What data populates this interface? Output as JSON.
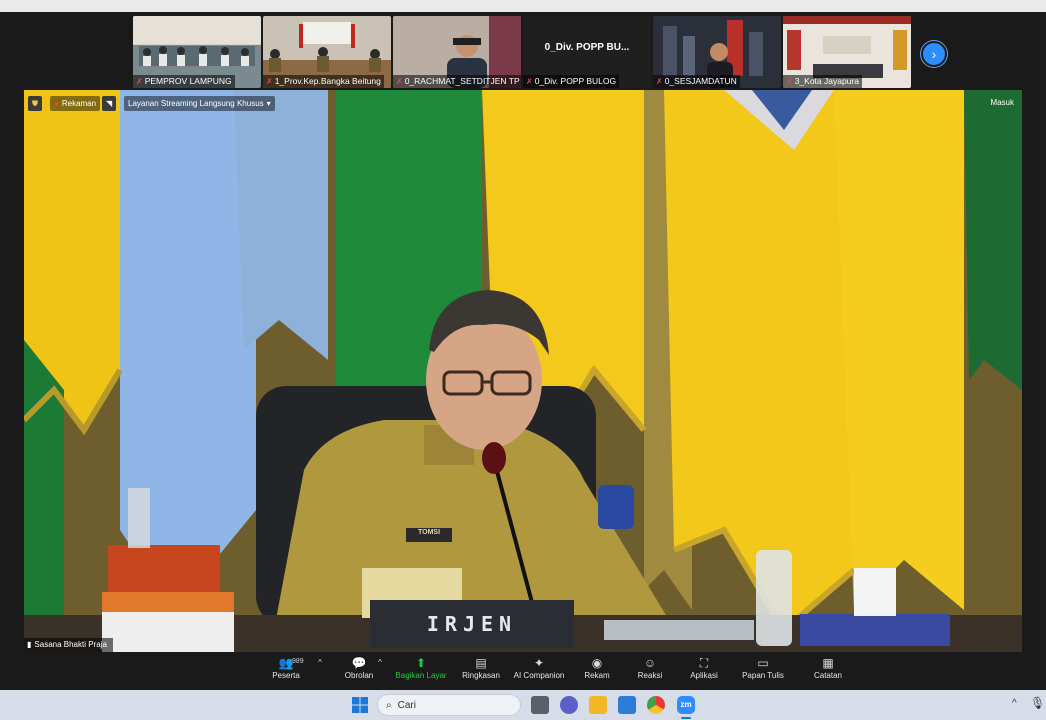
{
  "thumbnails": [
    {
      "name": "PEMPROV LAMPUNG"
    },
    {
      "name": "1_Prov.Kep.Bangka Beitung"
    },
    {
      "name": "0_RACHMAT_SETDITJEN TP"
    },
    {
      "name": "0_Div. POPP BULOG",
      "center": "0_Div. POPP BU..."
    },
    {
      "name": "0_SESJAMDATUN"
    },
    {
      "name": "3_Kota Jayapura"
    }
  ],
  "topbar": {
    "recording": "Rekaman",
    "streaming": "Layanan Streaming Langsung Khusus",
    "join": "Masuk"
  },
  "speaker": {
    "location": "Sasana Bhakti Praja",
    "nameplate": "IRJEN",
    "badge": "TOMSI"
  },
  "toolbar": {
    "participants_count": "989",
    "items": [
      {
        "label": "Peserta",
        "icon": "participants-icon"
      },
      {
        "label": "Obrolan",
        "icon": "chat-icon"
      },
      {
        "label": "Bagikan Layar",
        "icon": "share-screen-icon"
      },
      {
        "label": "Ringkasan",
        "icon": "summary-icon"
      },
      {
        "label": "AI Companion",
        "icon": "ai-companion-icon"
      },
      {
        "label": "Rekam",
        "icon": "record-icon"
      },
      {
        "label": "Reaksi",
        "icon": "reaction-icon"
      },
      {
        "label": "Aplikasi",
        "icon": "apps-icon"
      },
      {
        "label": "Papan Tulis",
        "icon": "whiteboard-icon"
      },
      {
        "label": "Catatan",
        "icon": "notes-icon"
      }
    ]
  },
  "taskbar": {
    "search_placeholder": "Cari"
  },
  "colors": {
    "accent": "#2d8cff",
    "share_green": "#28c840",
    "flag_yellow": "#f2c81a",
    "flag_green": "#1f8a3a",
    "flag_blue": "#8fb6e6"
  }
}
